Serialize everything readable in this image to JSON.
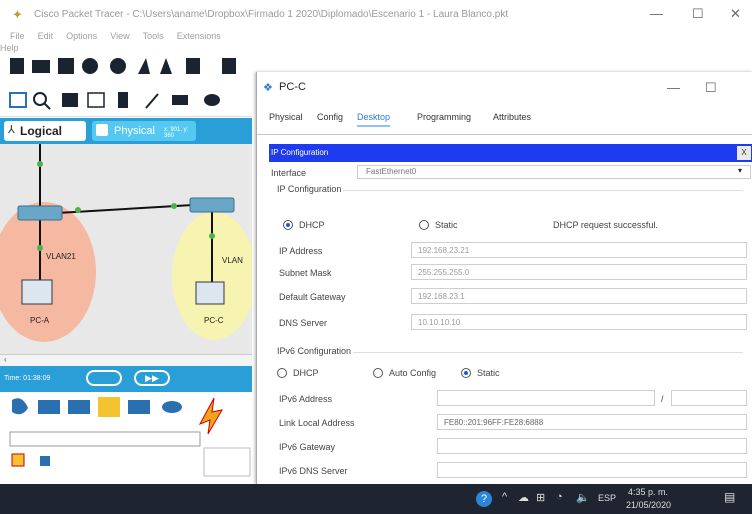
{
  "app": {
    "title": "Cisco Packet Tracer - C:\\Users\\aname\\Dropbox\\Firmado 1 2020\\Diplomado\\Escenario 1 - Laura Blanco.pkt",
    "menu": [
      "File",
      "Edit",
      "Options",
      "View",
      "Tools",
      "Extensions",
      "Help"
    ]
  },
  "workspace": {
    "logical_label": "Logical",
    "physical_label": "Physical",
    "coords": "x: 901, y: 360",
    "vlan_left": "VLAN21",
    "vlan_right": "VLAN",
    "pc_a": "PC-A",
    "pc_c": "PC-C"
  },
  "simbar": {
    "time": "Time: 01:38:09"
  },
  "pc_window": {
    "title": "PC-C",
    "tabs": [
      "Physical",
      "Config",
      "Desktop",
      "Programming",
      "Attributes"
    ],
    "active_tab": "Desktop",
    "section_title": "IP Configuration",
    "close_x": "X",
    "interface_label": "Interface",
    "interface_value": "FastEthernet0",
    "ipconfig_header": "IP Configuration",
    "dhcp_label": "DHCP",
    "static_label": "Static",
    "dhcp_status": "DHCP request successful.",
    "fields": [
      {
        "label": "IP Address",
        "value": "192.168.23.21"
      },
      {
        "label": "Subnet Mask",
        "value": "255.255.255.0"
      },
      {
        "label": "Default Gateway",
        "value": "192.168.23.1"
      },
      {
        "label": "DNS Server",
        "value": "10.10.10.10"
      }
    ],
    "ipv6_header": "IPv6 Configuration",
    "ipv6_dhcp": "DHCP",
    "ipv6_auto": "Auto Config",
    "ipv6_static": "Static",
    "ipv6_fields": [
      {
        "label": "IPv6 Address",
        "value": ""
      },
      {
        "label": "Link Local Address",
        "value": "FE80::201:96FF:FE28:6888"
      },
      {
        "label": "IPv6 Gateway",
        "value": ""
      },
      {
        "label": "IPv6 DNS Server",
        "value": ""
      }
    ],
    "prefix_sep": "/"
  },
  "taskbar": {
    "lang": "ESP",
    "time": "4:35 p. m.",
    "date": "21/05/2020"
  },
  "colors": {
    "accent": "#2a9ed7",
    "ipbar": "#1f3bf0",
    "taskbar": "#1e2530"
  }
}
